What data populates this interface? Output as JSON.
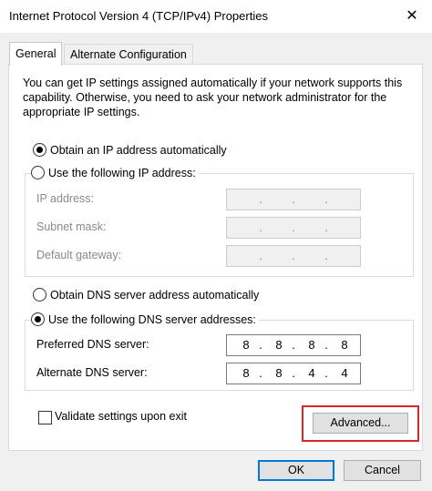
{
  "window": {
    "title": "Internet Protocol Version 4 (TCP/IPv4) Properties",
    "close_glyph": "✕"
  },
  "tabs": [
    {
      "label": "General",
      "active": true
    },
    {
      "label": "Alternate Configuration",
      "active": false
    }
  ],
  "description": "You can get IP settings assigned automatically if your network supports this capability. Otherwise, you need to ask your network administrator for the appropriate IP settings.",
  "ip_section": {
    "auto_label": "Obtain an IP address automatically",
    "manual_label": "Use the following IP address:",
    "selected": "auto",
    "fields": [
      {
        "label": "IP address:",
        "value": [
          "",
          "",
          "",
          ""
        ],
        "enabled": false
      },
      {
        "label": "Subnet mask:",
        "value": [
          "",
          "",
          "",
          ""
        ],
        "enabled": false
      },
      {
        "label": "Default gateway:",
        "value": [
          "",
          "",
          "",
          ""
        ],
        "enabled": false
      }
    ]
  },
  "dns_section": {
    "auto_label": "Obtain DNS server address automatically",
    "manual_label": "Use the following DNS server addresses:",
    "selected": "manual",
    "fields": [
      {
        "label": "Preferred DNS server:",
        "value": [
          "8",
          "8",
          "8",
          "8"
        ],
        "enabled": true
      },
      {
        "label": "Alternate DNS server:",
        "value": [
          "8",
          "8",
          "4",
          "4"
        ],
        "enabled": true
      }
    ]
  },
  "validate": {
    "label": "Validate settings upon exit",
    "checked": false
  },
  "buttons": {
    "advanced": "Advanced...",
    "ok": "OK",
    "cancel": "Cancel"
  },
  "highlight_color": "#d7262e",
  "accent_color": "#0078d7",
  "ip_dot": "."
}
